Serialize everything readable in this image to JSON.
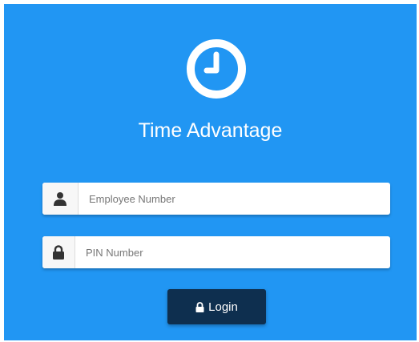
{
  "app": {
    "logo_icon": "clock-icon",
    "title": "Time Advantage"
  },
  "form": {
    "employee": {
      "icon": "user-icon",
      "placeholder": "Employee Number",
      "value": ""
    },
    "pin": {
      "icon": "lock-icon",
      "placeholder": "PIN Number",
      "value": ""
    },
    "login": {
      "icon": "lock-icon",
      "label": "Login"
    }
  },
  "colors": {
    "background": "#2196f3",
    "button": "#0e2f4f",
    "text_light": "#ffffff"
  }
}
